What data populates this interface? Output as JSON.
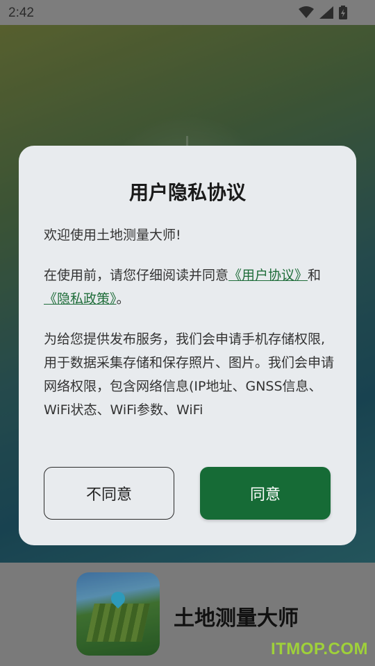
{
  "status_bar": {
    "time": "2:42",
    "icons": [
      "wifi-icon",
      "signal-icon",
      "battery-icon"
    ]
  },
  "dialog": {
    "title": "用户隐私协议",
    "welcome": "欢迎使用土地测量大师!",
    "intro_prefix": "在使用前，请您仔细阅读并同意",
    "link_user_agreement": "《用户协议》",
    "and_text": "和",
    "link_privacy_policy": "《隐私政策》",
    "intro_suffix": "。",
    "permissions_text": "为给您提供发布服务，我们会申请手机存储权限,用于数据采集存储和保存照片、图片。我们会申请网络权限，包含网络信息(IP地址、GNSS信息、WiFi状态、WiFi参数、WiFi",
    "disagree_label": "不同意",
    "agree_label": "同意"
  },
  "brand": {
    "app_name": "土地测量大师",
    "watermark": "ITMOP.COM"
  },
  "colors": {
    "accent": "#166b36",
    "link": "#1f6d3a",
    "dialog_bg": "#e8ebee",
    "watermark": "#9fd13a"
  }
}
